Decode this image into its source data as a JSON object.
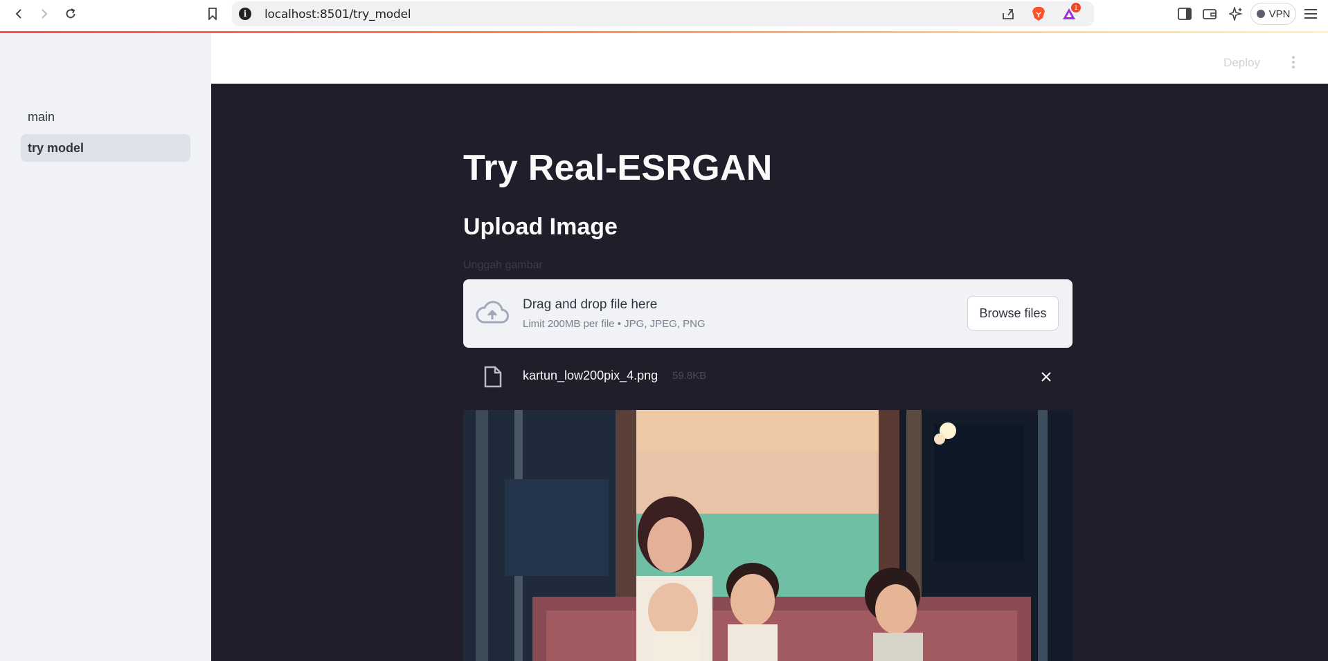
{
  "browser": {
    "url": "localhost:8501/try_model",
    "vpn_label": "VPN",
    "notification_count": "1"
  },
  "sidebar": {
    "items": [
      {
        "label": "main",
        "active": false
      },
      {
        "label": "try model",
        "active": true
      }
    ]
  },
  "header": {
    "deploy_label": "Deploy"
  },
  "main": {
    "title": "Try Real-ESRGAN",
    "subheader": "Upload Image",
    "uploader": {
      "label": "Unggah gambar",
      "drop_text": "Drag and drop file here",
      "limit_text": "Limit 200MB per file • JPG, JPEG, PNG",
      "browse_label": "Browse files"
    },
    "uploaded_file": {
      "name": "kartun_low200pix_4.png",
      "size": "59.8KB"
    }
  },
  "colors": {
    "accent": "#ff4b4b",
    "main_bg": "#1f1e2a",
    "sidebar_bg": "#f0f2f6",
    "dropzone_bg": "#f0f2f6"
  },
  "icons": [
    "back-icon",
    "forward-icon",
    "reload-icon",
    "bookmark-icon",
    "info-icon",
    "share-icon",
    "brave-lion-icon",
    "brave-rewards-icon",
    "sidebar-toggle-icon",
    "wallet-icon",
    "leo-ai-icon",
    "menu-icon",
    "cloud-upload-icon",
    "file-icon",
    "close-icon",
    "kebab-menu-icon"
  ]
}
